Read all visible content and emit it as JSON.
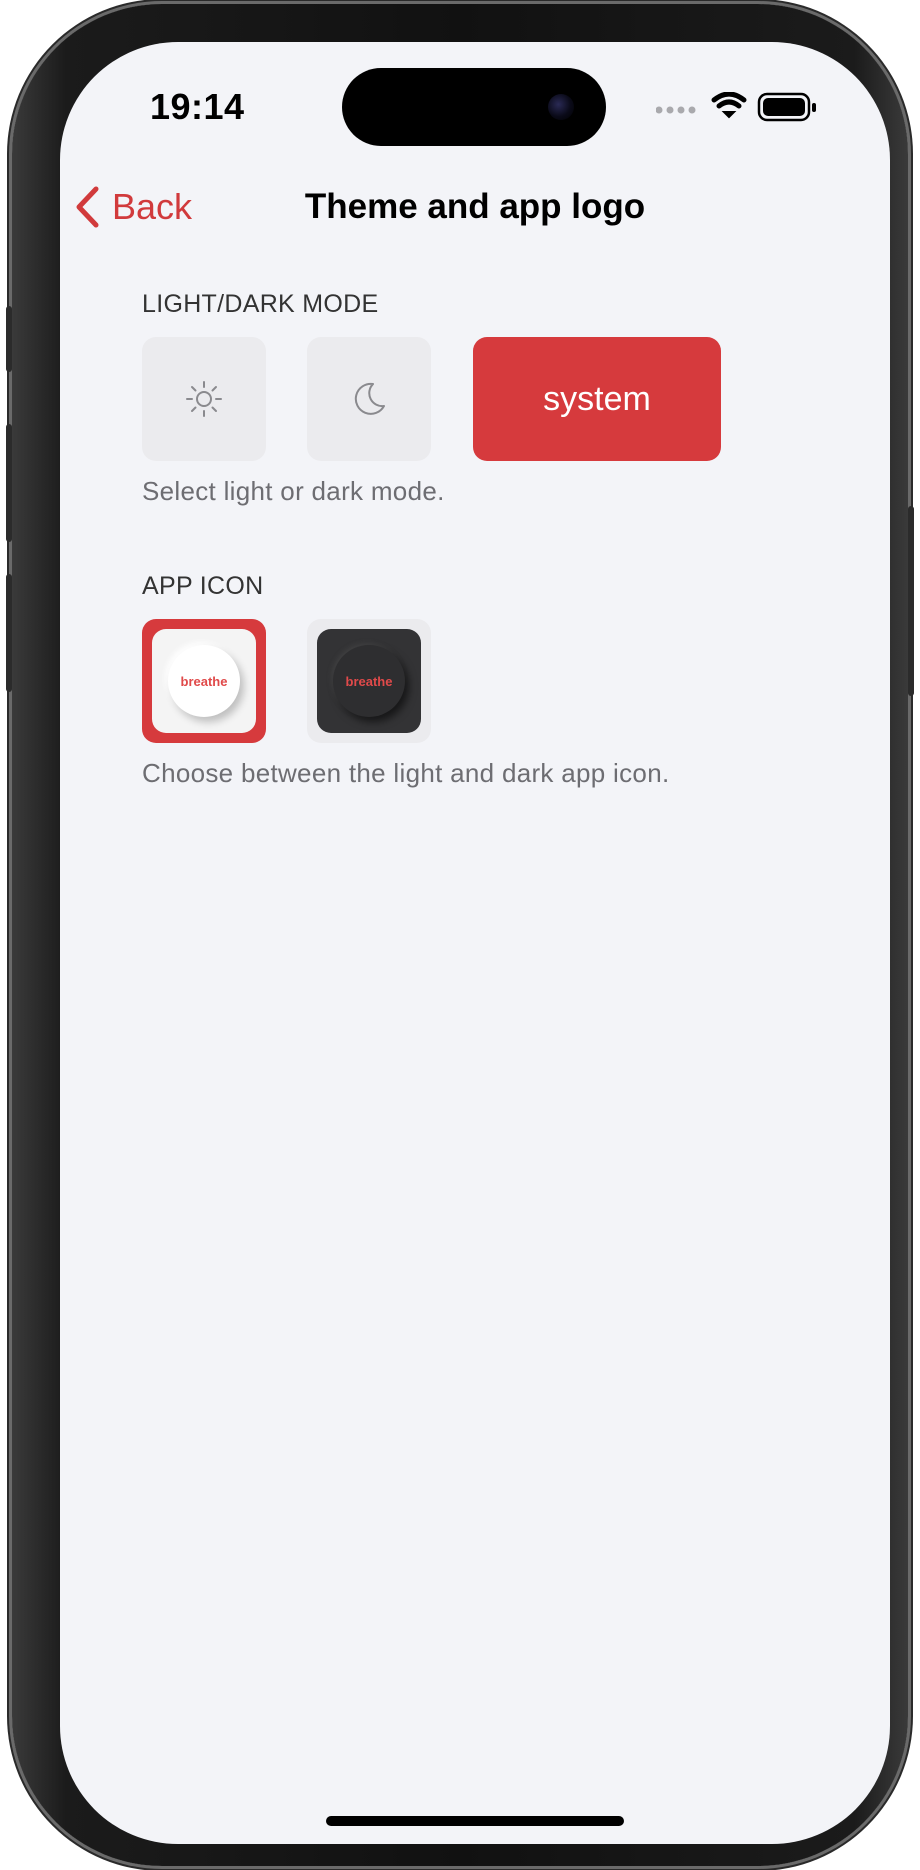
{
  "status_bar": {
    "time": "19:14",
    "icons": [
      "cellular-dots-icon",
      "wifi-icon",
      "battery-icon"
    ]
  },
  "nav": {
    "back_label": "Back",
    "title": "Theme and app logo"
  },
  "theme_section": {
    "header": "LIGHT/DARK MODE",
    "options": [
      {
        "icon": "sun-icon",
        "selected": false
      },
      {
        "icon": "moon-icon",
        "selected": false
      },
      {
        "label": "system",
        "selected": true
      }
    ],
    "footer": "Select light or dark mode."
  },
  "icon_section": {
    "header": "APP ICON",
    "options": [
      {
        "variant": "light",
        "label": "breathe",
        "selected": true
      },
      {
        "variant": "dark",
        "label": "breathe",
        "selected": false
      }
    ],
    "footer": "Choose between the light and dark app icon."
  },
  "colors": {
    "accent": "#d63a3d",
    "background": "#f3f4f8",
    "tile": "#ebebee"
  }
}
